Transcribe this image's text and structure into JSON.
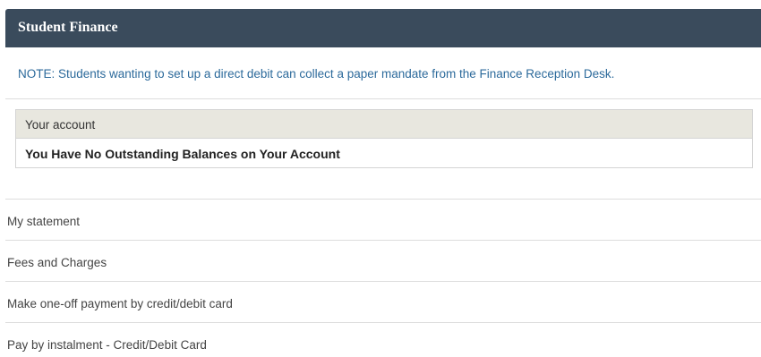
{
  "panel": {
    "title": "Student Finance"
  },
  "note": "NOTE: Students wanting to set up a direct debit can collect a paper mandate from the Finance Reception Desk.",
  "account": {
    "header": "Your account",
    "status": "You Have No Outstanding Balances on Your Account"
  },
  "links": [
    {
      "label": "My statement"
    },
    {
      "label": "Fees and Charges"
    },
    {
      "label": "Make one-off payment by credit/debit card"
    },
    {
      "label": "Pay by instalment - Credit/Debit Card"
    }
  ],
  "colors": {
    "header_bg": "#3a4b5c",
    "note_text": "#2c6a9b",
    "table_header_bg": "#e8e7df"
  }
}
